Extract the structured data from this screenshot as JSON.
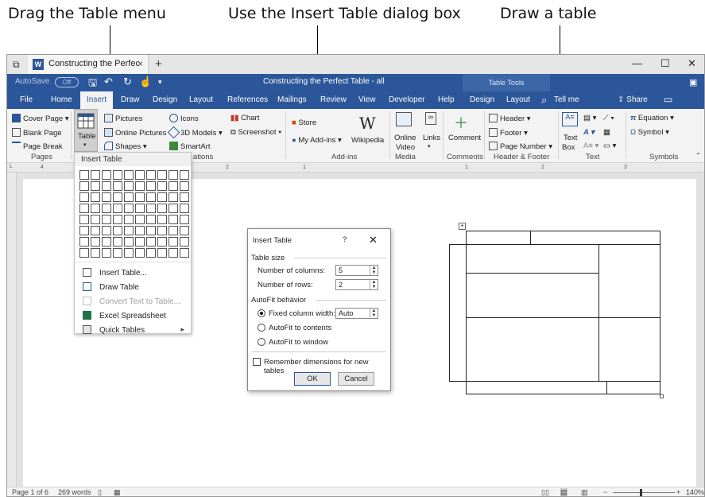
{
  "callouts": {
    "left": "Drag the Table menu",
    "middle": "Use the Insert Table dialog box",
    "right": "Draw a table"
  },
  "titlebar": {
    "tab_title": "Constructing the Perfec",
    "close_tab": "×",
    "new_tab": "+",
    "minimize": "—",
    "maximize": "☐",
    "close": "✕"
  },
  "qat": {
    "autosave": "AutoSave",
    "autosave_state": "Off",
    "document_title": "Constructing the Perfect Table - all",
    "table_tools": "Table Tools"
  },
  "menu": {
    "items": [
      "File",
      "Home",
      "Insert",
      "Draw",
      "Design",
      "Layout",
      "References",
      "Mailings",
      "Review",
      "View",
      "Developer",
      "Help",
      "Design",
      "Layout"
    ],
    "active": "Insert",
    "tell_me": "Tell me",
    "share": "Share"
  },
  "ribbon": {
    "pages": {
      "cover_page": "Cover Page",
      "blank_page": "Blank Page",
      "page_break": "Page Break",
      "label": "Pages"
    },
    "table": {
      "label": "Table"
    },
    "illustrations": {
      "pictures": "Pictures",
      "online_pictures": "Online Pictures",
      "shapes": "Shapes",
      "icons": "Icons",
      "models": "3D Models",
      "smartart": "SmartArt",
      "chart": "Chart",
      "screenshot": "Screenshot",
      "label_fragment": "ations"
    },
    "addins": {
      "store": "Store",
      "my_addins": "My Add-ins",
      "wikipedia": "Wikipedia",
      "label": "Add-ins"
    },
    "media": {
      "online_video_1": "Online",
      "online_video_2": "Video",
      "label": "Media"
    },
    "links": {
      "label": "Links"
    },
    "comments": {
      "comment": "Comment",
      "label": "Comments"
    },
    "header_footer": {
      "header": "Header",
      "footer": "Footer",
      "page_number": "Page Number",
      "label": "Header & Footer"
    },
    "text": {
      "text_box_1": "Text",
      "text_box_2": "Box",
      "label": "Text"
    },
    "symbols": {
      "equation": "Equation",
      "symbol": "Symbol",
      "label": "Symbols"
    }
  },
  "ruler": {
    "marks": [
      "4",
      "2",
      "1",
      "1",
      "2",
      "3"
    ]
  },
  "dropdown": {
    "header": "Insert Table",
    "grid_cols": 10,
    "grid_rows": 8,
    "items": [
      {
        "label": "Insert Table...",
        "icon": "insert-table-icon",
        "disabled": false
      },
      {
        "label": "Draw Table",
        "icon": "draw-table-icon",
        "disabled": false
      },
      {
        "label": "Convert Text to Table...",
        "icon": "convert-text-icon",
        "disabled": true
      },
      {
        "label": "Excel Spreadsheet",
        "icon": "excel-icon",
        "disabled": false
      },
      {
        "label": "Quick Tables",
        "icon": "quick-tables-icon",
        "disabled": false
      }
    ]
  },
  "dialog": {
    "title": "Insert Table",
    "help": "?",
    "close": "✕",
    "table_size": "Table size",
    "columns_label": "Number of columns:",
    "columns_value": "5",
    "rows_label": "Number of rows:",
    "rows_value": "2",
    "autofit": "AutoFit behavior",
    "fixed_width": "Fixed column width:",
    "fixed_value": "Auto",
    "autofit_contents": "AutoFit to contents",
    "autofit_window": "AutoFit to window",
    "remember": "Remember dimensions for new tables",
    "ok": "OK",
    "cancel": "Cancel"
  },
  "status": {
    "page": "Page 1 of 6",
    "words": "269 words",
    "zoom": "140%"
  },
  "colors": {
    "word_blue": "#2b579a",
    "ribbon_bg": "#f3f3f3"
  }
}
